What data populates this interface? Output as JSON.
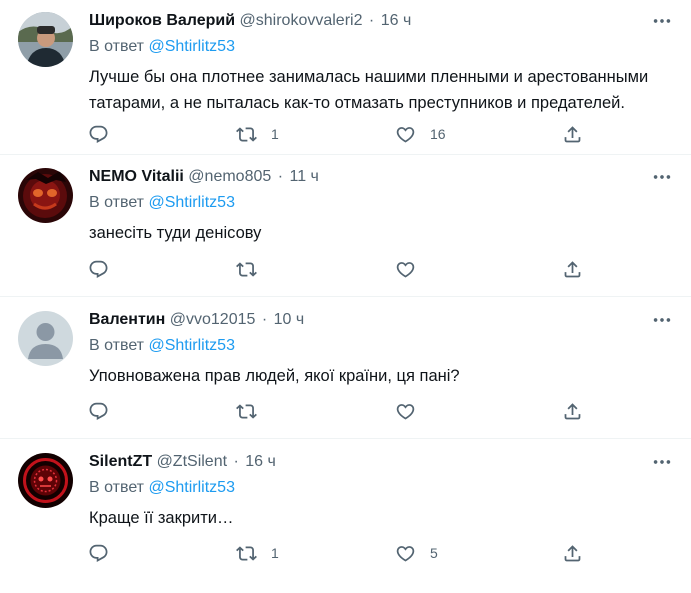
{
  "tweets": [
    {
      "name": "Широков Валерий",
      "handle": "@shirokovvaleri2",
      "dot": "·",
      "time": "16 ч",
      "reply_prefix": "В ответ",
      "reply_to": "@Shtirlitz53",
      "text": "Лучше бы она плотнее занималась нашими пленными и арестованными татарами, а не пыталась как-то отмазать преступников и предателей.",
      "retweets": "1",
      "likes": "16"
    },
    {
      "name": "NEMO Vitalii",
      "handle": "@nemo805",
      "dot": "·",
      "time": "11 ч",
      "reply_prefix": "В ответ",
      "reply_to": "@Shtirlitz53",
      "text": "занесіть туди денісову",
      "retweets": "",
      "likes": ""
    },
    {
      "name": "Валентин",
      "handle": "@vvo12015",
      "dot": "·",
      "time": "10 ч",
      "reply_prefix": "В ответ",
      "reply_to": "@Shtirlitz53",
      "text": "Уповноважена прав людей, якої країни, ця пані?",
      "retweets": "",
      "likes": ""
    },
    {
      "name": "SilentZT",
      "handle": "@ZtSilent",
      "dot": "·",
      "time": "16 ч",
      "reply_prefix": "В ответ",
      "reply_to": "@Shtirlitz53",
      "text": "Краще її закрити…",
      "retweets": "1",
      "likes": "5"
    }
  ],
  "colors": {
    "text": "#0f1419",
    "muted": "#536471",
    "link": "#1d9bf0",
    "divider": "#eff3f4"
  },
  "icons": [
    "reply-icon",
    "retweet-icon",
    "like-icon",
    "share-icon",
    "more-icon"
  ]
}
